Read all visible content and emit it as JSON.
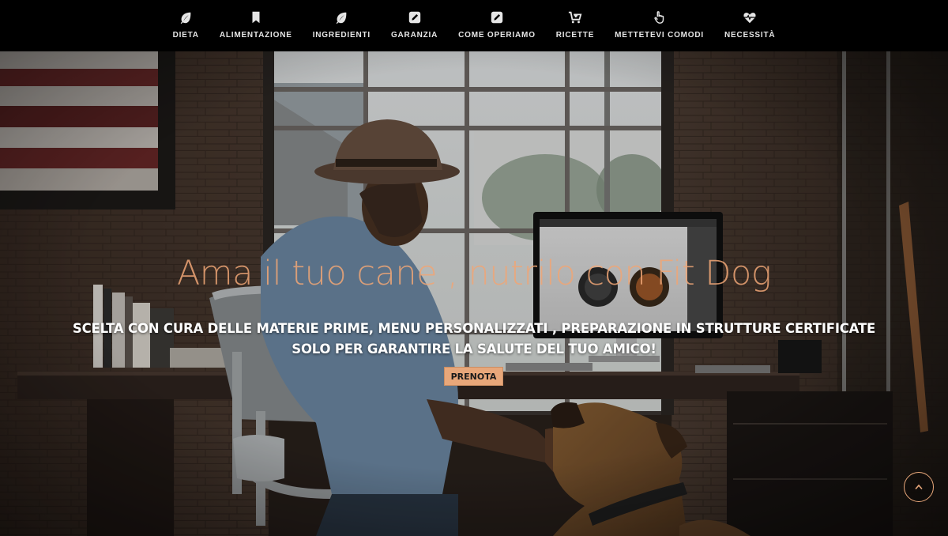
{
  "nav": {
    "items": [
      {
        "label": "DIETA",
        "icon": "leaf-icon"
      },
      {
        "label": "ALIMENTAZIONE",
        "icon": "bookmark-icon"
      },
      {
        "label": "INGREDIENTI",
        "icon": "leaf-icon"
      },
      {
        "label": "GARANZIA",
        "icon": "edit-icon"
      },
      {
        "label": "COME OPERIAMO",
        "icon": "edit-icon"
      },
      {
        "label": "RICETTE",
        "icon": "cart-icon"
      },
      {
        "label": "METTETEVI COMODI",
        "icon": "hand-pointer-icon"
      },
      {
        "label": "NECESSITÀ",
        "icon": "heartbeat-icon"
      }
    ]
  },
  "hero": {
    "headline": "Ama il tuo cane , nutrilo con Fit Dog",
    "subtitle_line1": "SCELTA CON CURA DELLE MATERIE PRIME, MENU PERSONALIZZATI , PREPARAZIONE IN STRUTTURE CERTIFICATE",
    "subtitle_line2": "SOLO PER GARANTIRE LA SALUTE DEL TUO AMICO!",
    "cta_label": "PRENOTA"
  },
  "scroll_top": {
    "icon": "chevron-up-icon"
  },
  "colors": {
    "accent": "#e8a77a",
    "headline": "#f0a676",
    "nav_bg": "#000000",
    "nav_text": "#e6e6e6"
  }
}
